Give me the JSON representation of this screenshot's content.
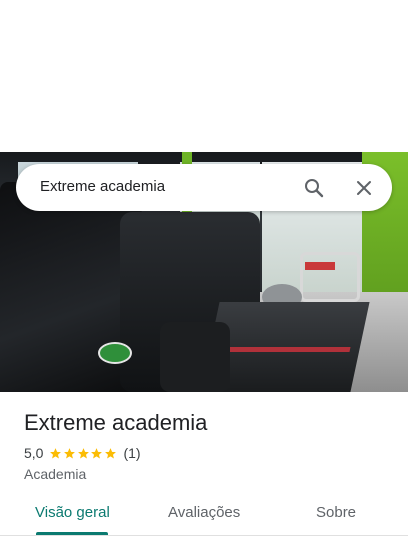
{
  "search": {
    "query": "Extreme academia"
  },
  "place": {
    "name": "Extreme academia",
    "rating": "5,0",
    "stars": 5,
    "review_count": "(1)",
    "category": "Academia"
  },
  "tabs": [
    {
      "label": "Visão geral",
      "active": true
    },
    {
      "label": "Avaliações",
      "active": false
    },
    {
      "label": "Sobre",
      "active": false
    }
  ],
  "colors": {
    "accent": "#0b7a70",
    "star": "#fbbc04"
  },
  "icons": {
    "search": "search-icon",
    "close": "close-icon"
  }
}
